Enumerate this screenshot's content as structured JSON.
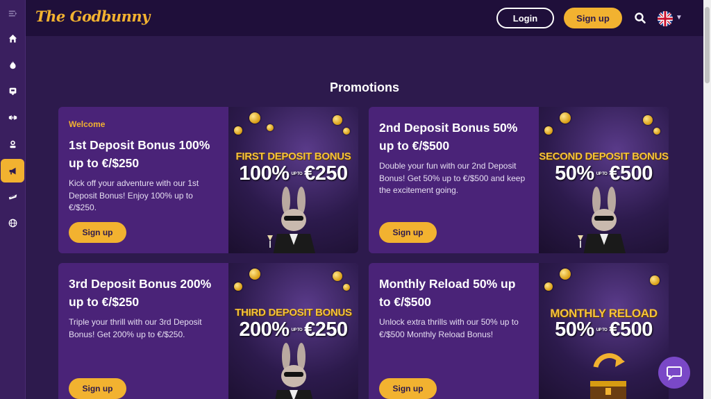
{
  "brand": {
    "logo_text": "The Godbunny"
  },
  "header": {
    "login_label": "Login",
    "signup_label": "Sign up",
    "search_icon": "search-icon",
    "language": "en-GB",
    "language_flag_icon": "uk-flag-icon"
  },
  "sidebar": {
    "items": [
      {
        "icon": "menu-collapse-icon"
      },
      {
        "icon": "home-icon"
      },
      {
        "icon": "fire-icon"
      },
      {
        "icon": "slot-icon"
      },
      {
        "icon": "cards-icon"
      },
      {
        "icon": "live-dealer-icon"
      },
      {
        "icon": "megaphone-icon",
        "active": true
      },
      {
        "icon": "sports-icon"
      },
      {
        "icon": "globe-icon"
      }
    ]
  },
  "page": {
    "title": "Promotions"
  },
  "promotions": [
    {
      "tag": "Welcome",
      "title": "1st Deposit Bonus 100% up to €/$250",
      "description": "Kick off your adventure with our 1st Deposit Bonus! Enjoy 100% up to €/$250.",
      "button": "Sign up",
      "banner_heading": "FIRST DEPOSIT BONUS",
      "banner_percent": "100%",
      "banner_upto": "UP TO",
      "banner_amount": "€250"
    },
    {
      "tag": "",
      "title": "2nd Deposit Bonus 50% up to €/$500",
      "description": "Double your fun with our 2nd Deposit Bonus! Get 50% up to €/$500 and keep the excitement going.",
      "button": "Sign up",
      "banner_heading": "SECOND DEPOSIT BONUS",
      "banner_percent": "50%",
      "banner_upto": "UP TO",
      "banner_amount": "€500"
    },
    {
      "tag": "",
      "title": "3rd Deposit Bonus 200% up to €/$250",
      "description": "Triple your thrill with our 3rd Deposit Bonus! Get 200% up to €/$250.",
      "button": "Sign up",
      "banner_heading": "THIRD DEPOSIT BONUS",
      "banner_percent": "200%",
      "banner_upto": "UP TO",
      "banner_amount": "€250"
    },
    {
      "tag": "",
      "title": "Monthly Reload 50% up to €/$500",
      "description": "Unlock extra thrills with our 50% up to €/$500 Monthly Reload Bonus!",
      "button": "Sign up",
      "banner_heading": "MONTHLY RELOAD",
      "banner_percent": "50%",
      "banner_upto": "UP TO",
      "banner_amount": "€500"
    }
  ],
  "chat": {
    "icon": "chat-bubble-icon"
  },
  "colors": {
    "accent": "#f2b230",
    "background": "#2d1a4d",
    "card": "#4a2378",
    "header": "#1f0f3a"
  }
}
